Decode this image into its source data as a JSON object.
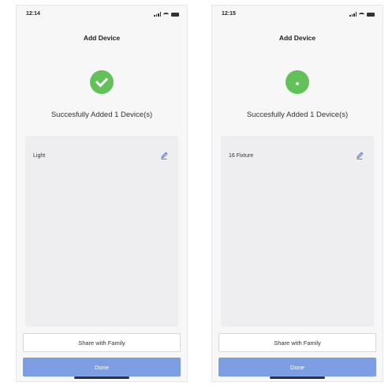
{
  "screens": [
    {
      "status_time": "12:14",
      "title": "Add Device",
      "success_icon": "check-icon",
      "success_message": "Succesfully Added 1 Device(s)",
      "device_name": "Light",
      "share_label": "Share with Family",
      "done_label": "Done"
    },
    {
      "status_time": "12:15",
      "title": "Add Device",
      "success_icon": "dot-icon",
      "success_message": "Succesfully Added 1 Device(s)",
      "device_name": "16 Fixture",
      "share_label": "Share with Family",
      "done_label": "Done"
    }
  ],
  "colors": {
    "success": "#63c15a",
    "primary_button": "#7d9ee2",
    "edit_icon": "#5a7fd6",
    "panel": "#eeeef0"
  }
}
